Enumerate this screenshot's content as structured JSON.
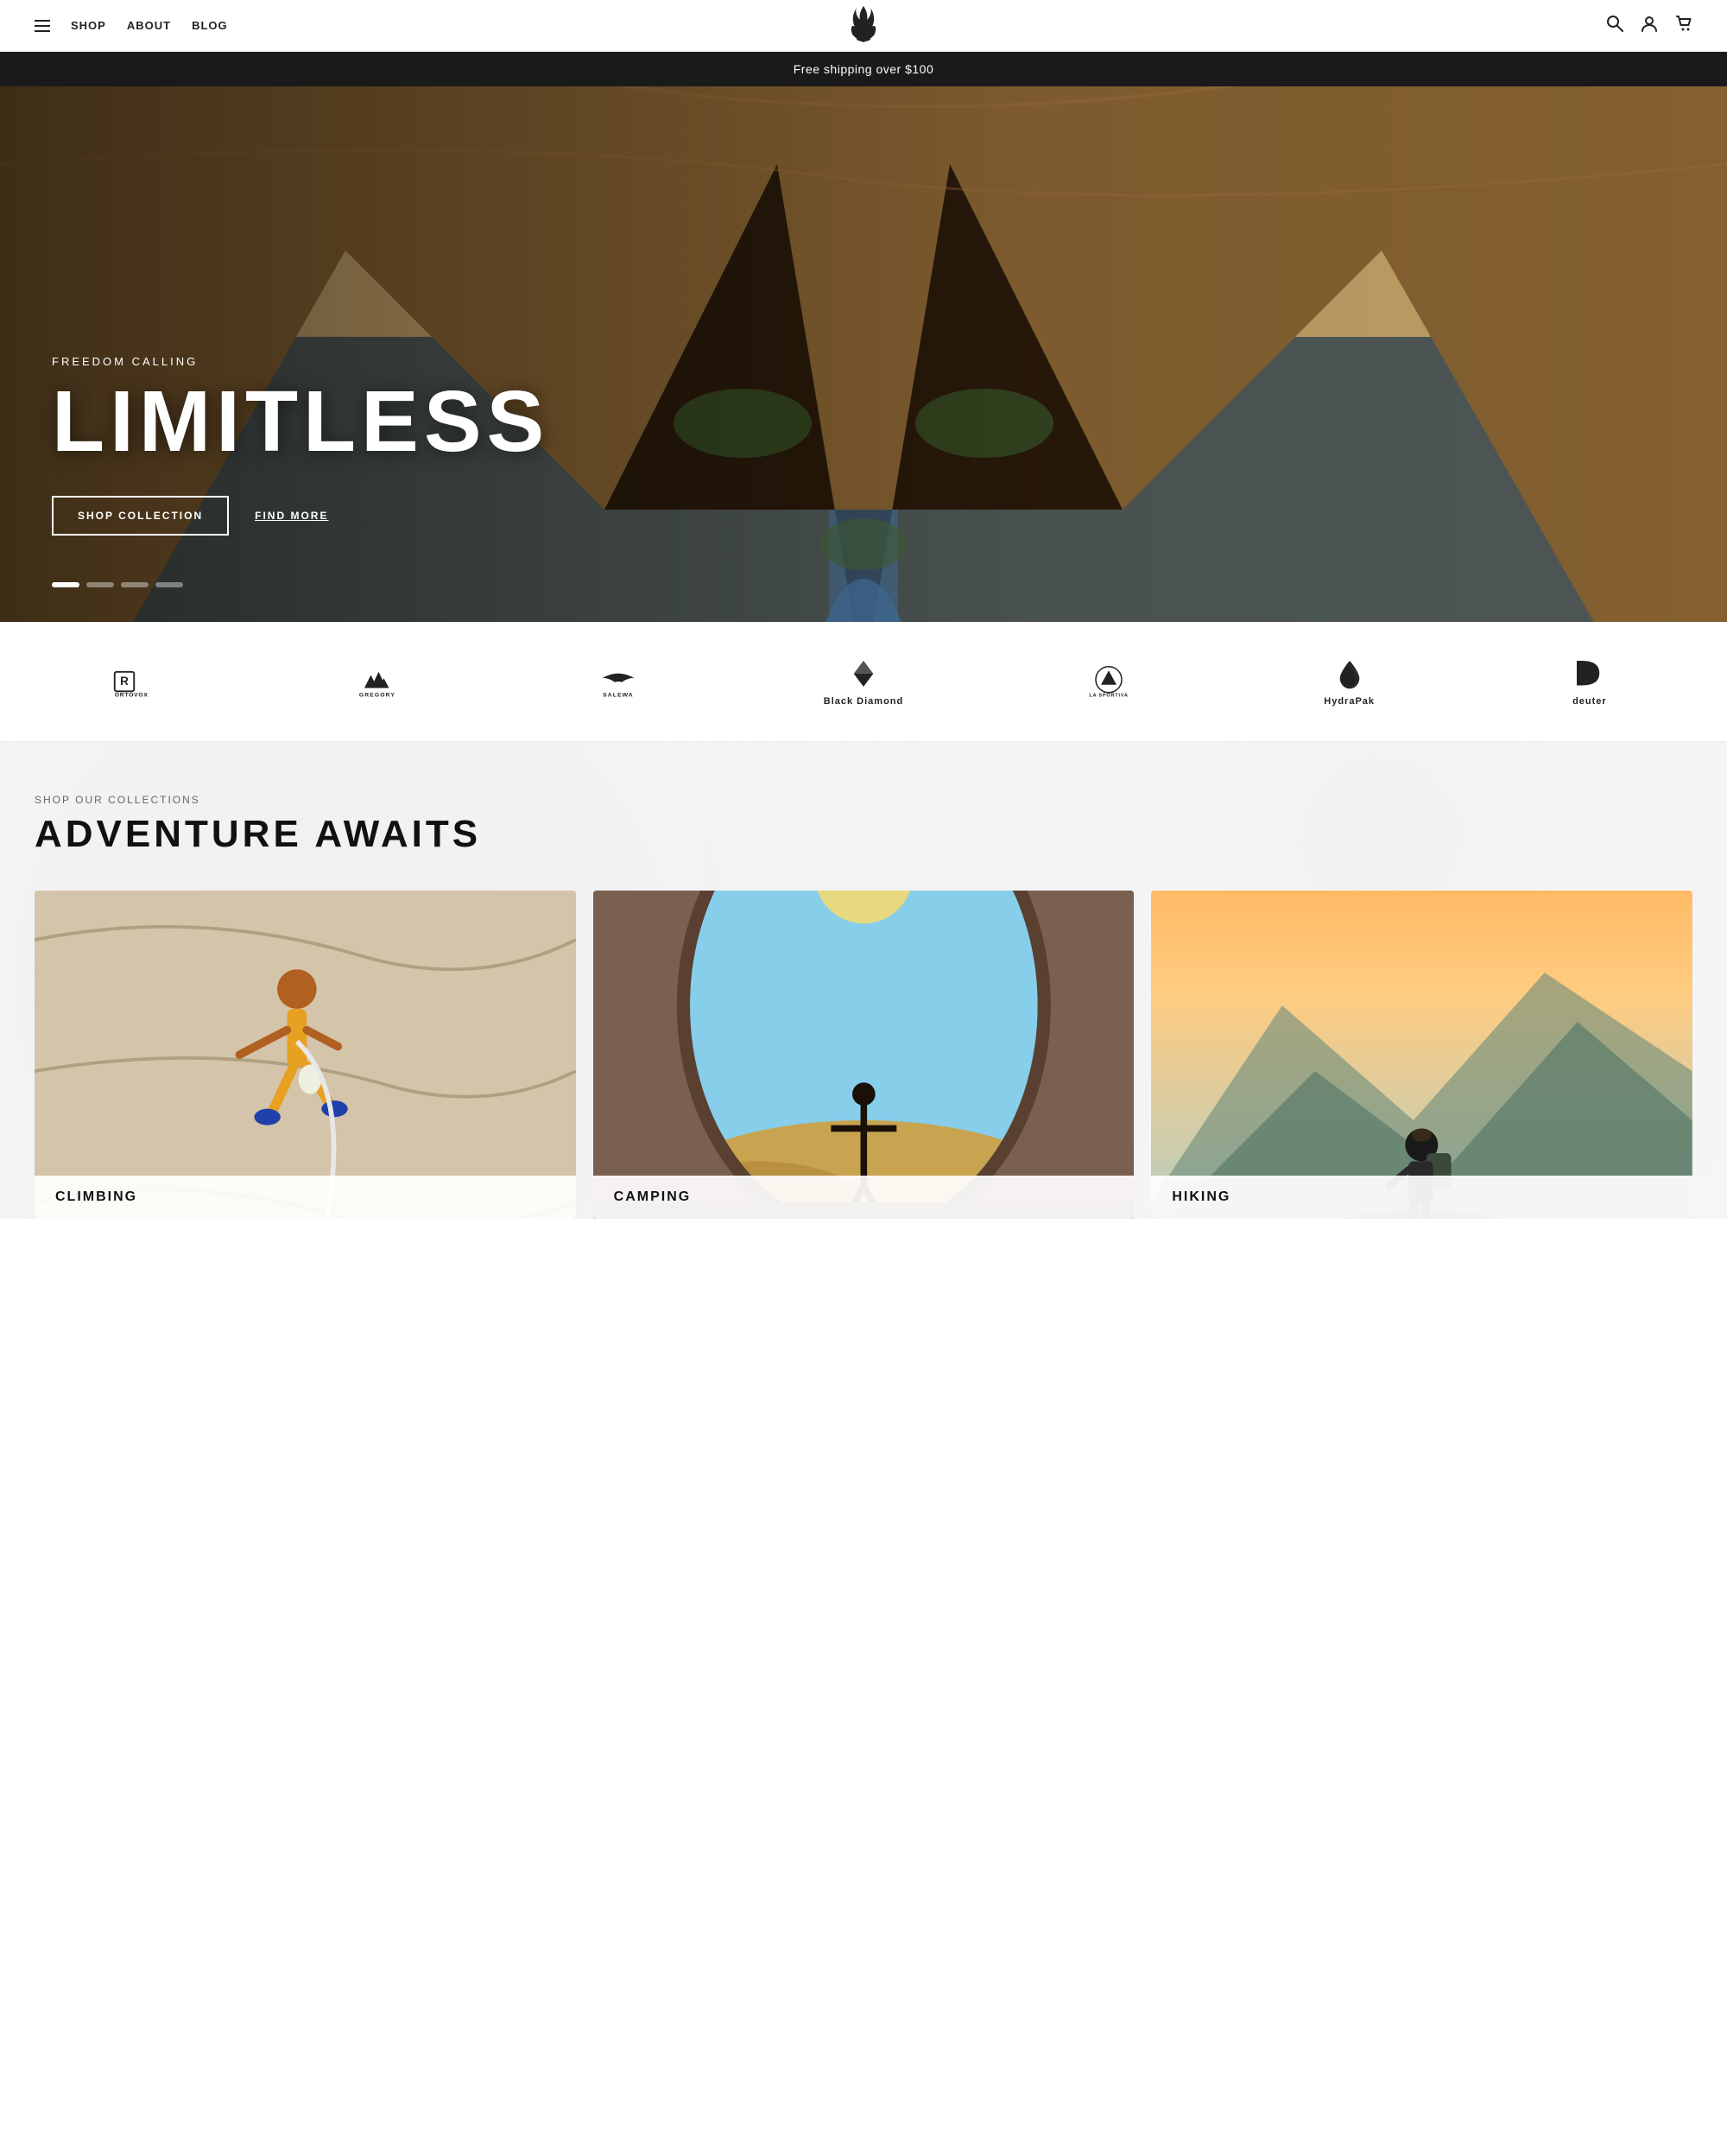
{
  "nav": {
    "menu_label": "SHOP",
    "links": [
      {
        "label": "SHOP",
        "id": "shop"
      },
      {
        "label": "ABOUT",
        "id": "about"
      },
      {
        "label": "BLOG",
        "id": "blog"
      }
    ],
    "logo_symbol": "🔥",
    "icons": {
      "search": "🔍",
      "account": "👤",
      "cart": "🛍"
    }
  },
  "announcement": {
    "text": "Free shipping over $100"
  },
  "hero": {
    "eyebrow": "FREEDOM CALLING",
    "title": "LIMITLESS",
    "buttons": {
      "shop": "SHOP COLLECTION",
      "find": "FIND MORE"
    },
    "dots": [
      {
        "active": true
      },
      {
        "active": false
      },
      {
        "active": false
      },
      {
        "active": false
      }
    ]
  },
  "brands": [
    {
      "name": "ORTOVOX",
      "id": "ortovox"
    },
    {
      "name": "GREGORY",
      "id": "gregory"
    },
    {
      "name": "SALEWA",
      "id": "salewa"
    },
    {
      "name": "Black Diamond",
      "id": "black-diamond"
    },
    {
      "name": "LA SPORTIVA",
      "id": "la-sportiva"
    },
    {
      "name": "HydraPak",
      "id": "hydrapak"
    },
    {
      "name": "deuter",
      "id": "deuter"
    }
  ],
  "collections": {
    "eyebrow": "SHOP OUR COLLECTIONS",
    "title": "ADVENTURE AWAITS",
    "cards": [
      {
        "label": "CLIMBING",
        "id": "climbing",
        "color1": "#8a7a6a",
        "color2": "#c8b89a"
      },
      {
        "label": "CAMPING",
        "id": "camping",
        "color1": "#b09060",
        "color2": "#7a6040"
      },
      {
        "label": "HIKING",
        "id": "hiking",
        "color1": "#6a8a7a",
        "color2": "#4a6a5a"
      }
    ]
  }
}
